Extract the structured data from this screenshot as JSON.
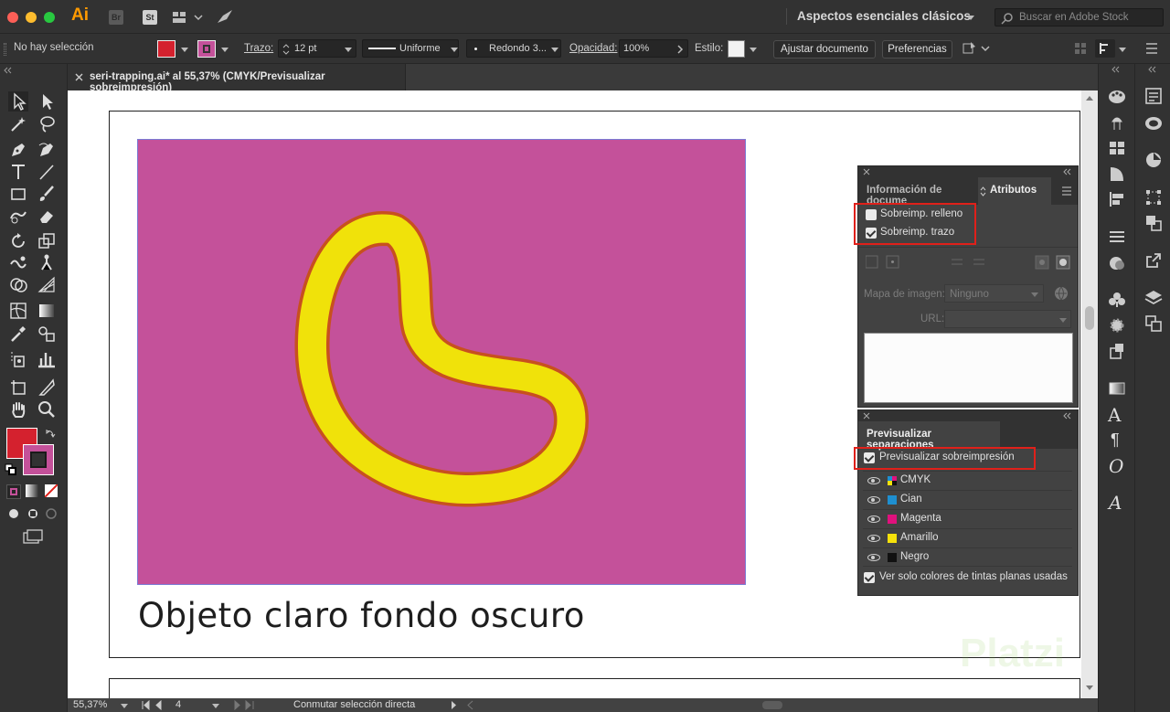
{
  "app": {
    "logo": "Ai",
    "bridge": "Br",
    "stock_btn": "St",
    "workspace": "Aspectos esenciales clásicos",
    "search_placeholder": "Buscar en Adobe Stock"
  },
  "control": {
    "selection": "No hay selección",
    "stroke_label": "Trazo:",
    "stroke_value": "12 pt",
    "profile": "Uniforme",
    "brush": "Redondo 3...",
    "opacity_label": "Opacidad:",
    "opacity_value": "100%",
    "style_label": "Estilo:",
    "fit_button": "Ajustar documento",
    "prefs_button": "Preferencias",
    "fill_color": "#d4212e",
    "stroke_color": "#c4519a"
  },
  "document": {
    "tab_title": "seri-trapping.ai* al 55,37% (CMYK/Previsualizar sobreimpresión)",
    "caption": "Objeto claro fondo oscuro",
    "background_color": "#c4519a",
    "shape_color": "#f0e20a",
    "shape_stroke": "#c8501e"
  },
  "attributes_panel": {
    "tab_doc_info": "Información de docume",
    "tab_attributes": "Atributos",
    "overprint_fill": "Sobreimp. relleno",
    "overprint_fill_checked": false,
    "overprint_stroke": "Sobreimp. trazo",
    "overprint_stroke_checked": true,
    "image_map_label": "Mapa de imagen:",
    "image_map_value": "Ninguno",
    "url_label": "URL:"
  },
  "separations_panel": {
    "title": "Previsualizar separaciones",
    "overprint_preview": "Previsualizar sobreimpresión",
    "overprint_preview_checked": true,
    "rows": [
      {
        "label": "CMYK",
        "icon": "cmyk-icon"
      },
      {
        "label": "Cian",
        "color": "#1e8fd0"
      },
      {
        "label": "Magenta",
        "color": "#e0117d"
      },
      {
        "label": "Amarillo",
        "color": "#f5e10a"
      },
      {
        "label": "Negro",
        "color": "#111111"
      }
    ],
    "spot_only": "Ver solo colores de tintas planas usadas",
    "spot_only_checked": true
  },
  "status": {
    "zoom": "55,37%",
    "artboard": "4",
    "tool_hint": "Conmutar selección directa"
  },
  "watermark": "Platzi"
}
